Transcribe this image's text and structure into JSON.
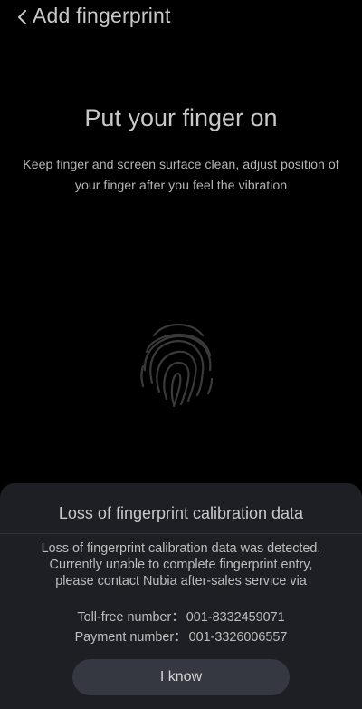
{
  "header": {
    "title": "Add fingerprint",
    "back_icon": "chevron-left-icon"
  },
  "main": {
    "title": "Put your finger on",
    "instructions": "Keep finger and screen surface clean, adjust position of your finger after you feel the vibration",
    "fingerprint_icon": "fingerprint-icon"
  },
  "dialog": {
    "title": "Loss of fingerprint calibration data",
    "message": "Loss of fingerprint calibration data was detected. Currently unable to complete fingerprint entry, please contact Nubia after-sales service via",
    "toll_free_label": "Toll-free number",
    "toll_free_number": "001-8332459071",
    "payment_label": "Payment number",
    "payment_number": "001-3326006557",
    "button_label": "I know"
  },
  "colors": {
    "background": "#000000",
    "sheet": "#1d1f25",
    "button": "#353841",
    "text": "#c8c8c8"
  }
}
